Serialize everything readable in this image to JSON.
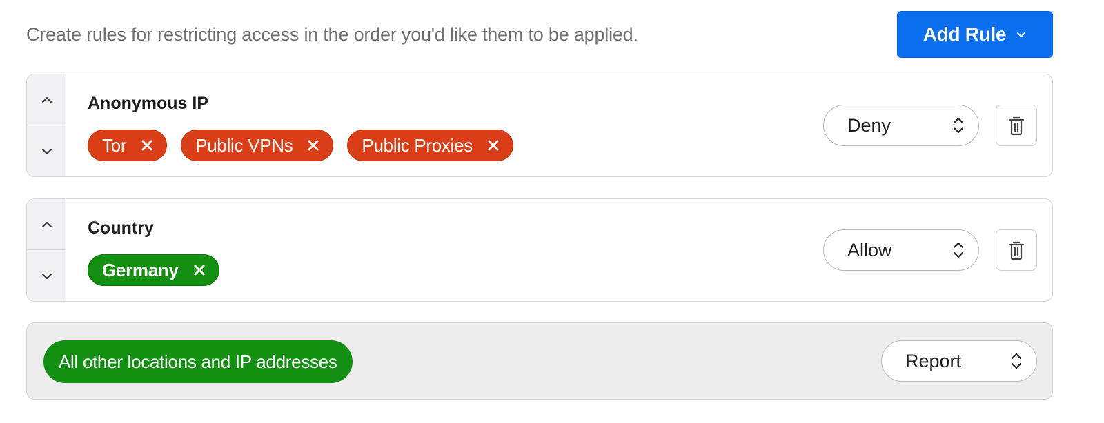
{
  "header": {
    "description": "Create rules for restricting access in the order you'd like them to be applied.",
    "add_rule_label": "Add Rule"
  },
  "rules": [
    {
      "title": "Anonymous IP",
      "chips": [
        "Tor",
        "Public VPNs",
        "Public Proxies"
      ],
      "chip_color": "#d93e17",
      "action": "Deny"
    },
    {
      "title": "Country",
      "chips": [
        "Germany"
      ],
      "chip_color": "#138f12",
      "action": "Allow"
    }
  ],
  "default_rule": {
    "label": "All other locations and IP addresses",
    "action": "Report"
  },
  "icons": {
    "add_rule": "chevron-down-icon",
    "move_up": "chevron-up-icon",
    "move_down": "chevron-down-icon",
    "remove_chip": "close-icon",
    "select": "up-down-chevron-icon",
    "delete": "trash-icon"
  },
  "colors": {
    "primary": "#0a6fef",
    "deny": "#d93e17",
    "allow": "#138f12"
  }
}
